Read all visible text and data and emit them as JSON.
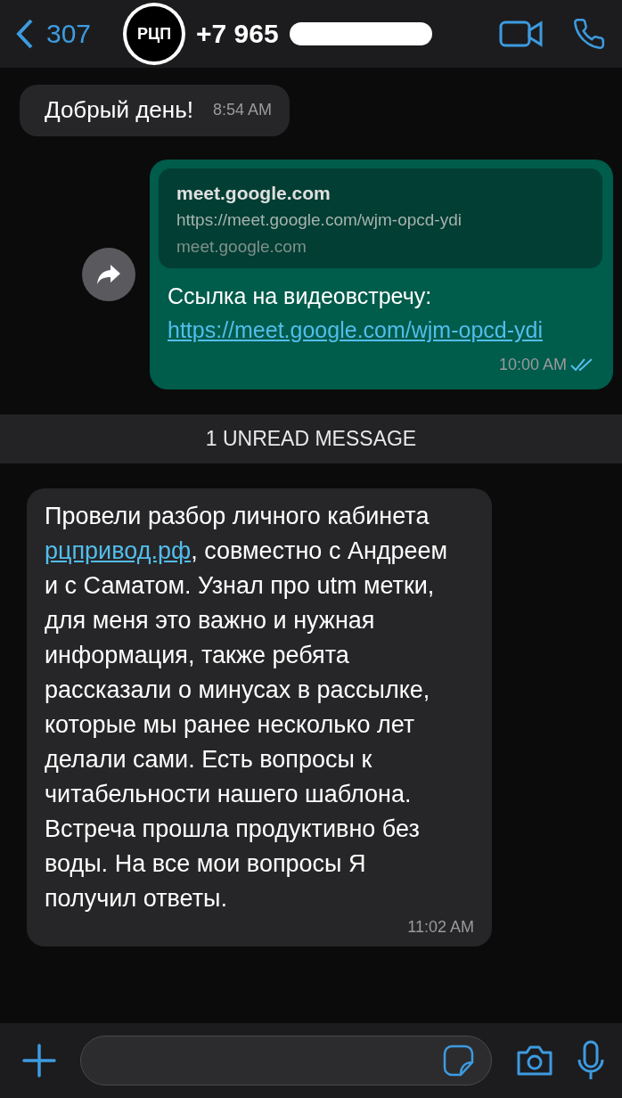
{
  "header": {
    "back_count": "307",
    "avatar_text": "РЦП",
    "phone": "+7 965",
    "phone_redacted": true
  },
  "messages": [
    {
      "kind": "incoming",
      "text": "Добрый день!",
      "time": "8:54 AM"
    },
    {
      "kind": "forwarded_link",
      "preview": {
        "title": "meet.google.com",
        "url": "https://meet.google.com/wjm-opcd-ydi",
        "domain": "meet.google.com"
      },
      "text": "Ссылка на видеовстречу: ",
      "link": "https://meet.google.com/wjm-opcd-ydi",
      "time": "10:00 AM",
      "read": true
    },
    {
      "kind": "divider",
      "text": "1 UNREAD MESSAGE"
    },
    {
      "kind": "incoming_link",
      "text_before": "Провели разбор личного кабинета ",
      "link": "рцпривод.рф",
      "text_after": ", совместно с Андреем и с Саматом. Узнал про utm метки, для меня это важно и нужная информация, также ребята рассказали о минусах в рассылке,  которые мы ранее несколько лет делали сами. Есть вопросы к читабельности нашего шаблона. Встреча прошла продуктивно без воды. На все мои вопросы Я получил ответы.",
      "time": "11:02 AM"
    }
  ]
}
